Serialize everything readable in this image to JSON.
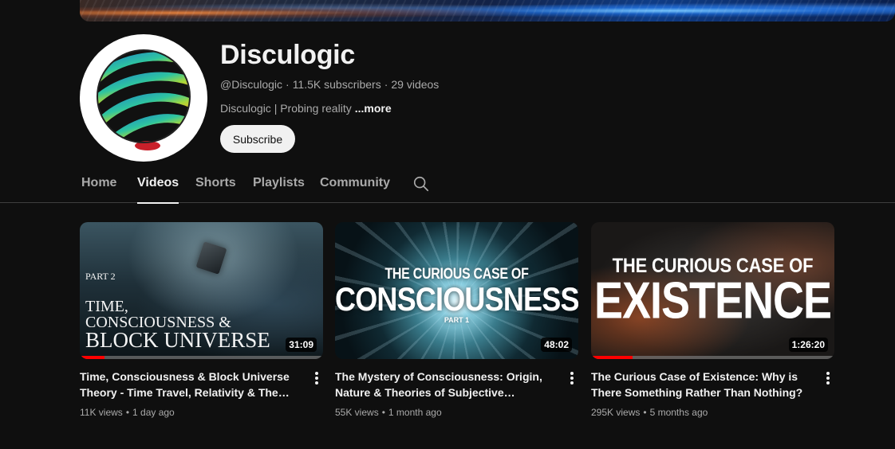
{
  "channel": {
    "name": "Disculogic",
    "handle": "@Disculogic",
    "subscribers": "11.5K subscribers",
    "videos_count": "29 videos",
    "description": "Disculogic | Probing reality",
    "more_label": "...more",
    "subscribe_label": "Subscribe",
    "avatar_icon": "striped-sphere-logo"
  },
  "tabs": [
    {
      "label": "Home",
      "active": false
    },
    {
      "label": "Videos",
      "active": true
    },
    {
      "label": "Shorts",
      "active": false
    },
    {
      "label": "Playlists",
      "active": false
    },
    {
      "label": "Community",
      "active": false
    }
  ],
  "search_icon": "search-icon",
  "videos": [
    {
      "title": "Time, Consciousness & Block Universe Theory - Time Travel, Relativity & The Illusi…",
      "views": "11K views",
      "age": "1 day ago",
      "duration": "31:09",
      "watched_fraction": 0.1,
      "thumb_text": [
        "PART 2",
        "TIME,",
        "CONSCIOUSNESS &",
        "BLOCK UNIVERSE"
      ]
    },
    {
      "title": "The Mystery of Consciousness: Origin, Nature & Theories of Subjective Experience…",
      "views": "55K views",
      "age": "1 month ago",
      "duration": "48:02",
      "watched_fraction": 0,
      "thumb_text": [
        "THE CURIOUS CASE OF",
        "CONSCIOUSNESS",
        "PART 1"
      ]
    },
    {
      "title": "The Curious Case of Existence: Why is There Something Rather Than Nothing?",
      "views": "295K views",
      "age": "5 months ago",
      "duration": "1:26:20",
      "watched_fraction": 0.17,
      "thumb_text": [
        "THE CURIOUS CASE OF",
        "EXISTENCE"
      ]
    }
  ],
  "colors": {
    "background": "#0f0f0f",
    "text_primary": "#f1f1f1",
    "text_secondary": "#aaaaaa",
    "progress": "#ff0000"
  }
}
